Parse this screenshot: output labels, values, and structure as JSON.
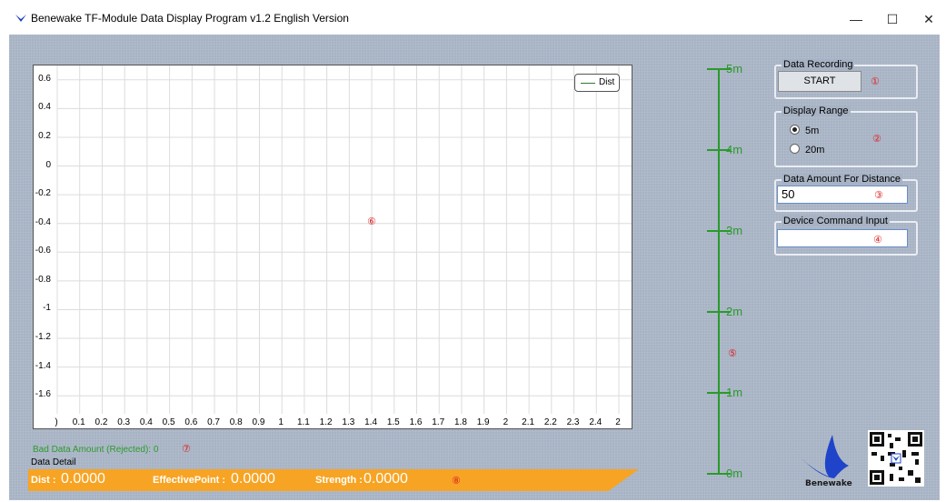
{
  "window": {
    "title": "Benewake TF-Module Data Display Program v1.2 English Version",
    "minimize_glyph": "—",
    "maximize_glyph": "☐",
    "close_glyph": "✕"
  },
  "chart_data": {
    "type": "line",
    "title": "",
    "xlabel": "",
    "ylabel": "",
    "y_ticks": [
      "0.6",
      "0.4",
      "0.2",
      "0",
      "-0.2",
      "-0.4",
      "-0.6",
      "-0.8",
      "-1",
      "-1.2",
      "-1.4",
      "-1.6"
    ],
    "x_ticks": [
      ")",
      "0.1",
      "0.2",
      "0.3",
      "0.4",
      "0.5",
      "0.6",
      "0.7",
      "0.8",
      "0.9",
      "1",
      "1.1",
      "1.2",
      "1.3",
      "1.4",
      "1.5",
      "1.6",
      "1.7",
      "1.8",
      "1.9",
      "2",
      "2.1",
      "2.2",
      "2.3",
      "2.4",
      "2"
    ],
    "ylim": [
      -1.7,
      0.7
    ],
    "xlim": [
      0,
      2.5
    ],
    "grid": true,
    "legend_position": "top-right",
    "series": [
      {
        "name": "Dist",
        "color": "#2d7a2d",
        "values": []
      }
    ]
  },
  "annotations": {
    "c1": "①",
    "c2": "②",
    "c3": "③",
    "c4": "④",
    "c5": "⑤",
    "c6": "⑥",
    "c7": "⑦",
    "c8": "⑧"
  },
  "distance_scale": {
    "labels": [
      "5m",
      "4m",
      "3m",
      "2m",
      "1m",
      "0m"
    ],
    "color": "#2a9a2a"
  },
  "data_recording": {
    "title": "Data Recording",
    "start_label": "START"
  },
  "display_range": {
    "title": "Display Range",
    "options": [
      "5m",
      "20m"
    ],
    "selected": "5m"
  },
  "data_amount": {
    "title": "Data Amount For Distance",
    "value": "50"
  },
  "device_command": {
    "title": "Device Command Input",
    "value": ""
  },
  "bad_data": {
    "label": "Bad Data Amount (Rejected): 0"
  },
  "data_detail": {
    "title": "Data Detail",
    "dist_label": "Dist :",
    "dist_value": "0.0000",
    "effective_label": "EffectivePoint :",
    "effective_value": "0.0000",
    "strength_label": "Strength :",
    "strength_value": "0.0000"
  },
  "logo": {
    "text": "Benewake"
  }
}
